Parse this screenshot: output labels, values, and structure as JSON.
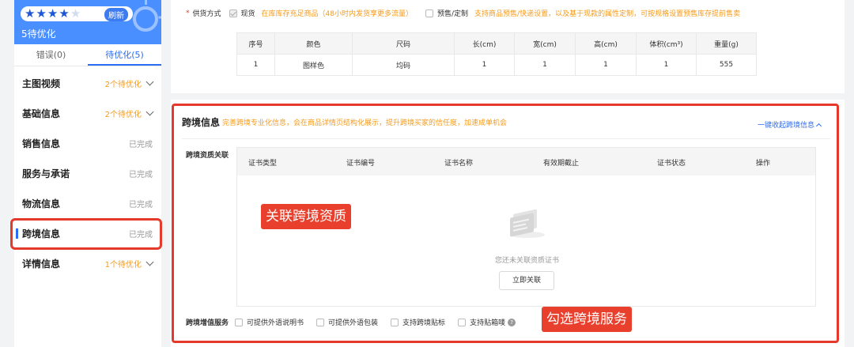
{
  "sidebar": {
    "rating_stars": 4,
    "rating_max": 5,
    "refresh_label": "刷新",
    "optimize_label": "5待优化",
    "tabs": [
      {
        "label": "错误(0)",
        "active": false
      },
      {
        "label": "待优化(5)",
        "active": true
      }
    ],
    "items": [
      {
        "label": "主图视频",
        "status": "2个待优化",
        "pending": true
      },
      {
        "label": "基础信息",
        "status": "2个待优化",
        "pending": true
      },
      {
        "label": "销售信息",
        "status": "已完成",
        "pending": false
      },
      {
        "label": "服务与承诺",
        "status": "已完成",
        "pending": false
      },
      {
        "label": "物流信息",
        "status": "已完成",
        "pending": false
      },
      {
        "label": "跨境信息",
        "status": "已完成",
        "pending": false,
        "active": true
      },
      {
        "label": "详情信息",
        "status": "1个待优化",
        "pending": true
      }
    ]
  },
  "supply": {
    "required_mark": "*",
    "label": "供货方式",
    "option1": "现货",
    "option1_note": "在库库存充足商品（48小时内发货享更多流量）",
    "option2": "预售/定制",
    "option2_note": "支持商品预售/快递设置，以及基于现款的属性定制，可按规格设置预售库存提前售卖"
  },
  "spec_table": {
    "headers": [
      "序号",
      "颜色",
      "尺码",
      "长(cm)",
      "宽(cm)",
      "高(cm)",
      "体积(cm³)",
      "重量(g)"
    ],
    "rows": [
      [
        "1",
        "图样色",
        "均码",
        "1",
        "1",
        "1",
        "1",
        "555"
      ]
    ]
  },
  "crossborder": {
    "title": "跨境信息",
    "description": "完善跨境专业化信息，会在商品详情页结构化展示，提升跨境买家的信任度，加速成单机会",
    "collapse_label": "一键收起跨境信息",
    "assoc_label": "跨境资质关联",
    "cert_headers": [
      "证书类型",
      "证书编号",
      "证书名称",
      "有效期截止",
      "证书状态",
      "操作"
    ],
    "empty_text": "您还未关联资质证书",
    "link_button": "立即关联",
    "vas_label": "跨境增值服务",
    "vas_options": [
      "可提供外语说明书",
      "可提供外语包装",
      "支持跨境贴标",
      "支持贴箱唛"
    ]
  },
  "callouts": {
    "assoc": "关联跨境资质",
    "service": "勾选跨境服务"
  },
  "colors": {
    "accent": "#2b6df5",
    "warning": "#f59b1b",
    "highlight": "#e5392b"
  }
}
